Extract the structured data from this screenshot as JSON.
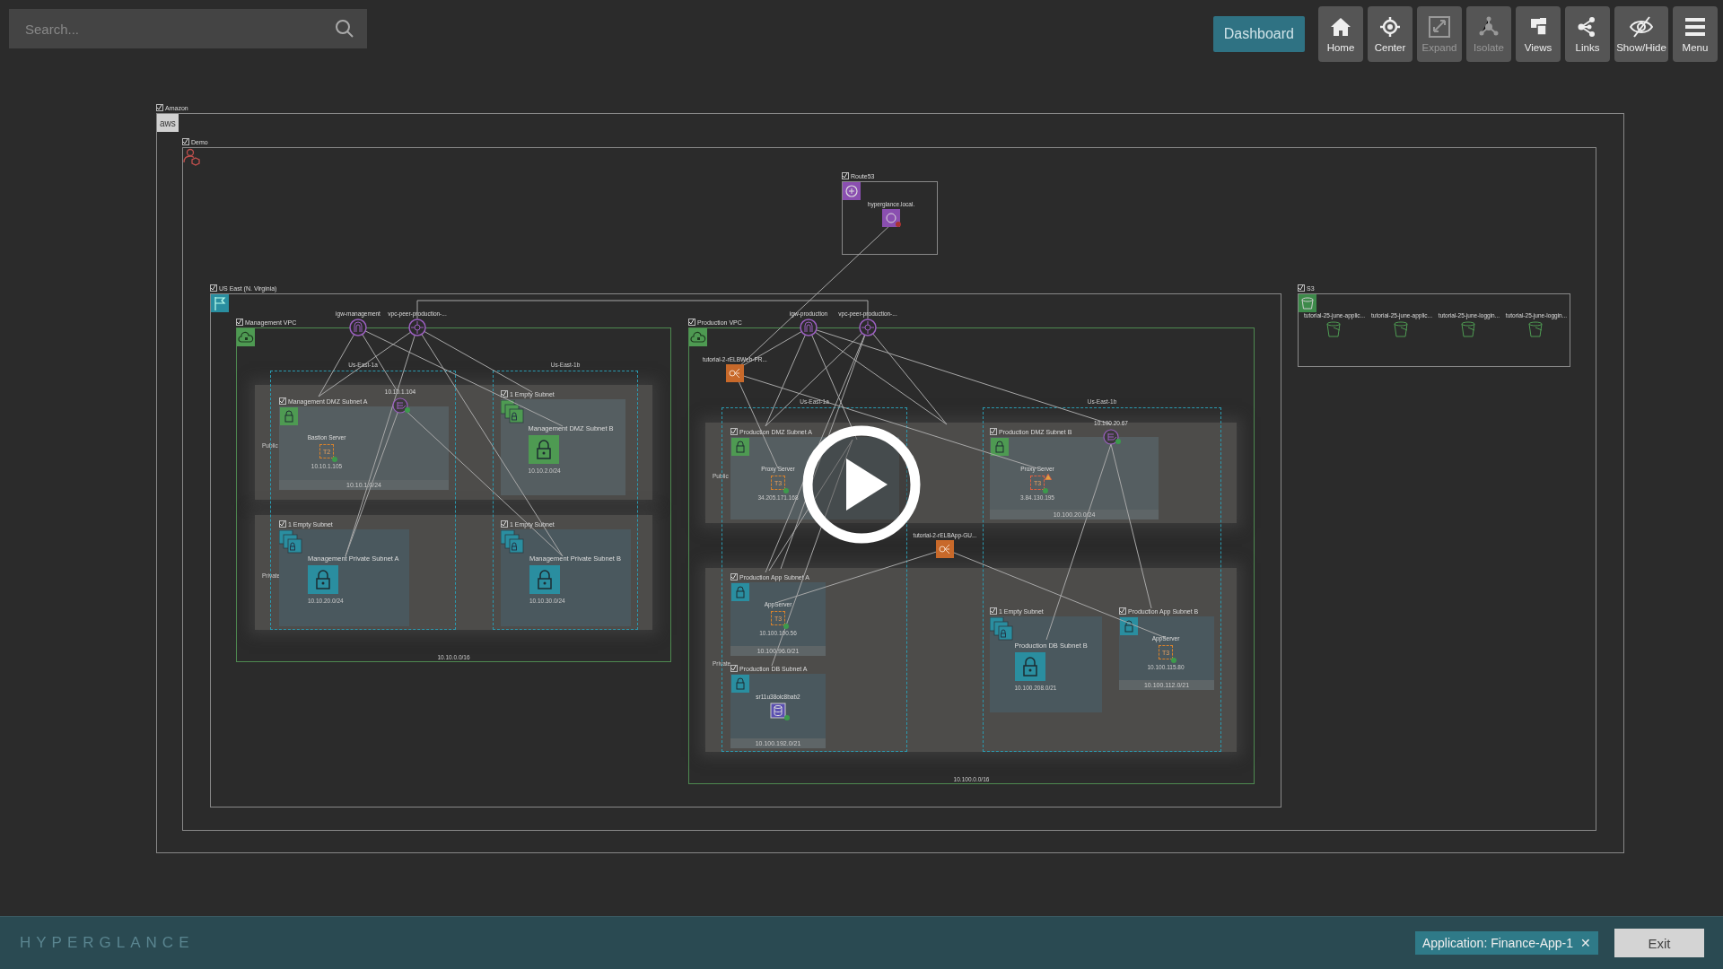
{
  "search": {
    "placeholder": "Search..."
  },
  "dashboard_button": "Dashboard",
  "toolbar": [
    {
      "kind": "home",
      "label": "Home",
      "disabled": false
    },
    {
      "kind": "center",
      "label": "Center",
      "disabled": false
    },
    {
      "kind": "expand",
      "label": "Expand",
      "disabled": true
    },
    {
      "kind": "isolate",
      "label": "Isolate",
      "disabled": true
    },
    {
      "kind": "views",
      "label": "Views",
      "disabled": false
    },
    {
      "kind": "links",
      "label": "Links",
      "disabled": false
    },
    {
      "kind": "showhide",
      "label": "Show/Hide",
      "disabled": false
    },
    {
      "kind": "menu",
      "label": "Menu",
      "disabled": false
    }
  ],
  "diagram": {
    "containers": [
      {
        "kind": "cloud",
        "label": "Amazon",
        "checked": true,
        "logo": "aws"
      },
      {
        "kind": "account",
        "label": "Demo",
        "checked": true
      },
      {
        "kind": "dns",
        "label": "Route53",
        "checked": true
      },
      {
        "kind": "region",
        "label": "US East (N. Virginia)",
        "checked": true
      },
      {
        "kind": "storage",
        "label": "S3",
        "checked": true
      },
      {
        "kind": "vpc",
        "label": "Management VPC",
        "checked": true,
        "cidr": "10.10.0.0/16"
      },
      {
        "kind": "vpc",
        "label": "Production VPC",
        "checked": true,
        "cidr": "10.100.0.0/16"
      }
    ],
    "zones": [
      "Us-East-1a",
      "Us-East-1b",
      "Us-East-1a",
      "Us-East-1b"
    ],
    "tiers": [
      "Public",
      "Private",
      "Public",
      "Private"
    ],
    "subnets": [
      {
        "kind": "public",
        "label": "Management DMZ Subnet A",
        "checked": true,
        "cidr": "10.10.1.0/24"
      },
      {
        "kind": "public-empty",
        "label": "1 Empty Subnet",
        "checked": true,
        "name": "Management DMZ Subnet B",
        "cidr": "10.10.2.0/24"
      },
      {
        "kind": "private-empty",
        "label": "1 Empty Subnet",
        "checked": true,
        "name": "Management Private Subnet A",
        "cidr": "10.10.20.0/24"
      },
      {
        "kind": "private-empty",
        "label": "1 Empty Subnet",
        "checked": true,
        "name": "Management Private Subnet B",
        "cidr": "10.10.30.0/24"
      },
      {
        "kind": "public",
        "label": "Production DMZ Subnet A",
        "checked": true
      },
      {
        "kind": "public",
        "label": "Production DMZ Subnet B",
        "checked": true,
        "cidr": "10.100.20.0/24"
      },
      {
        "kind": "private",
        "label": "Production App Subnet A",
        "checked": true,
        "cidr": "10.100.96.0/21"
      },
      {
        "kind": "private",
        "label": "Production DB Subnet A",
        "checked": true,
        "cidr": "10.100.192.0/21"
      },
      {
        "kind": "private-empty",
        "label": "1 Empty Subnet",
        "checked": true,
        "name": "Production DB Subnet B",
        "cidr": "10.100.208.0/21"
      },
      {
        "kind": "private",
        "label": "Production App Subnet B",
        "checked": true,
        "cidr": "10.100.112.0/21"
      }
    ],
    "nodes": [
      {
        "kind": "internet-gateway",
        "label": "igw-management"
      },
      {
        "kind": "peering",
        "label": "vpc-peer-production-..."
      },
      {
        "kind": "nat",
        "label": "10.10.1.104"
      },
      {
        "kind": "instance",
        "label": "Bastion Server",
        "chip": "T2",
        "ip": "10.10.1.105",
        "warning": false
      },
      {
        "kind": "dns-record",
        "label": "hyperglance.local."
      },
      {
        "kind": "internet-gateway",
        "label": "igw-production"
      },
      {
        "kind": "peering",
        "label": "vpc-peer-production-..."
      },
      {
        "kind": "load-balancer",
        "label": "tutorial-2-rELBWeb-PR..."
      },
      {
        "kind": "instance",
        "label": "Proxy Server",
        "chip": "T3",
        "ip": "34.205.171.168",
        "warning": false
      },
      {
        "kind": "instance",
        "label": "Proxy Server",
        "chip": "T3",
        "ip": "3.84.130.195",
        "warning": true
      },
      {
        "kind": "nat",
        "label": "10.100.20.67"
      },
      {
        "kind": "load-balancer",
        "label": "tutorial-2-rELBApp-GU..."
      },
      {
        "kind": "instance",
        "label": "AppServer",
        "chip": "T3",
        "ip": "10.100.100.56",
        "warning": false
      },
      {
        "kind": "database",
        "label": "sr11u38olc8bab2"
      },
      {
        "kind": "instance",
        "label": "AppServer",
        "chip": "T3",
        "ip": "10.100.115.80",
        "warning": false
      },
      {
        "kind": "bucket",
        "label": "tutorial-25-june-applic..."
      },
      {
        "kind": "bucket",
        "label": "tutorial-25-june-applic..."
      },
      {
        "kind": "bucket",
        "label": "tutorial-25-june-loggin..."
      },
      {
        "kind": "bucket",
        "label": "tutorial-25-june-loggin..."
      }
    ]
  },
  "footer": {
    "logo": "HYPERGLANCE",
    "application_tag": "Application: Finance-App-1",
    "close": "✕",
    "exit_button": "Exit"
  }
}
